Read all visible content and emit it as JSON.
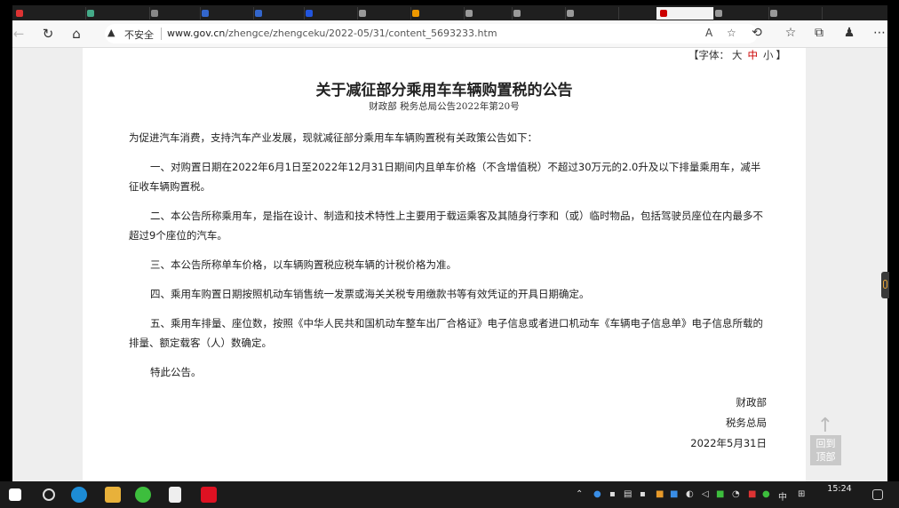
{
  "browser": {
    "address": {
      "security_label": "不安全",
      "url_domain": "www.gov.cn",
      "url_path": "/zhengce/zhengceku/2022-05/31/content_5693233.htm"
    }
  },
  "page": {
    "font_size_control": {
      "prefix": "【字体：",
      "large": "大",
      "medium": "中",
      "small": "小",
      "suffix": "】"
    },
    "title": "关于减征部分乘用车车辆购置税的公告",
    "subtitle": "财政部  税务总局公告2022年第20号",
    "paragraphs": [
      "为促进汽车消费，支持汽车产业发展，现就减征部分乘用车车辆购置税有关政策公告如下：",
      "一、对购置日期在2022年6月1日至2022年12月31日期间内且单车价格（不含增值税）不超过30万元的2.0升及以下排量乘用车，减半征收车辆购置税。",
      "二、本公告所称乘用车，是指在设计、制造和技术特性上主要用于载运乘客及其随身行李和（或）临时物品，包括驾驶员座位在内最多不超过9个座位的汽车。",
      "三、本公告所称单车价格，以车辆购置税应税车辆的计税价格为准。",
      "四、乘用车购置日期按照机动车销售统一发票或海关关税专用缴款书等有效凭证的开具日期确定。",
      "五、乘用车排量、座位数，按照《中华人民共和国机动车整车出厂合格证》电子信息或者进口机动车《车辆电子信息单》电子信息所载的排量、额定载客（人）数确定。",
      "特此公告。"
    ],
    "signature": {
      "org1": "财政部",
      "org2": "税务总局",
      "date": "2022年5月31日"
    },
    "back_to_top": {
      "line1": "回到",
      "line2": "顶部"
    }
  },
  "taskbar": {
    "clock": "15:24",
    "ime": "中"
  }
}
